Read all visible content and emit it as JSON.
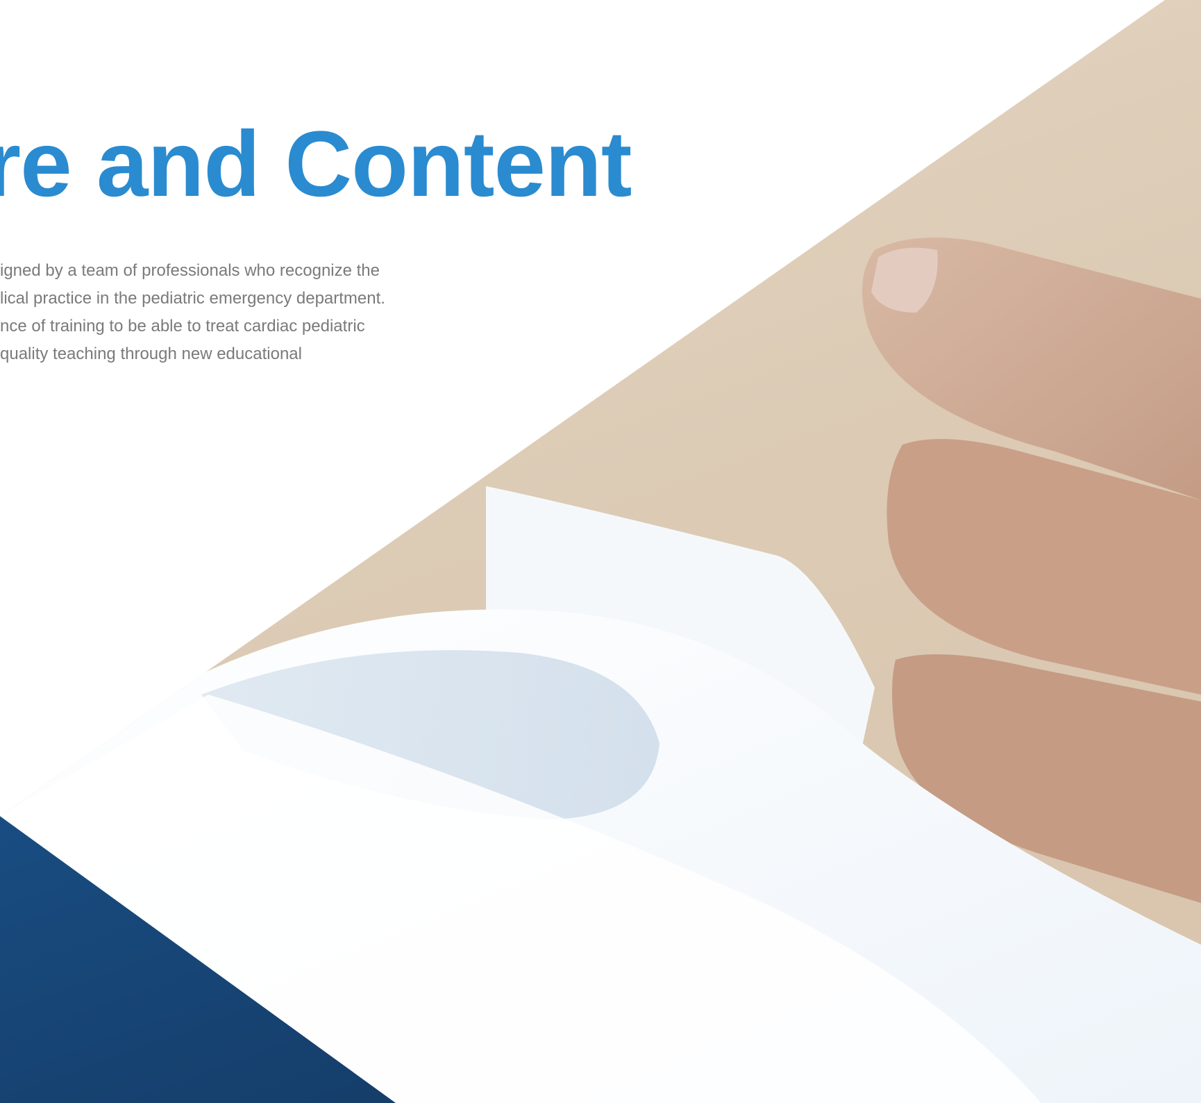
{
  "heading": {
    "text": "re and Content",
    "color": "#2a8bd0"
  },
  "body": {
    "lines": [
      "igned by a team of professionals who recognize the",
      "lical practice in the pediatric emergency department.",
      "nce of training to be able to treat cardiac pediatric",
      " quality teaching through new educational"
    ],
    "color": "#7a7a7a"
  },
  "colors": {
    "corner_light": "#2a78b8",
    "corner_dark": "#12335a",
    "skin": "#d9c4ad",
    "cloth": "#f4f8fc"
  }
}
